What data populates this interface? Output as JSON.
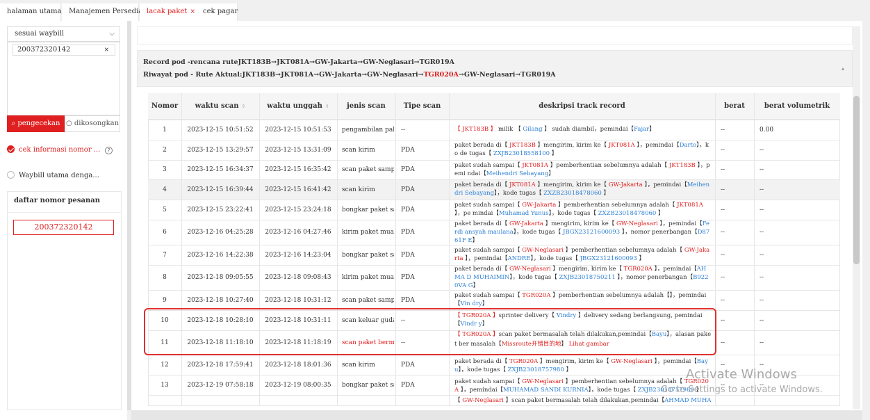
{
  "tabs": [
    {
      "label": "halaman utama"
    },
    {
      "label": "Manajemen Persediaan"
    },
    {
      "label": "lacak paket",
      "close": "×"
    },
    {
      "label": "cek pagar"
    }
  ],
  "sidebar": {
    "select_value": "sesuai waybill",
    "chevron": "⌵",
    "tag_value": "200372320142",
    "tag_close": "×",
    "search_label": "pengecekan",
    "search_icon": "⌕",
    "clear_label": "dikosongkan",
    "clear_icon": "○",
    "option1": "cek informasi nomor ...",
    "option1_help": "?",
    "option2": "Waybill utama denga...",
    "daftar_title": "daftar nomor pesanan",
    "order_item": "200372320142"
  },
  "route": {
    "record_prefix": "Record pod -rencana rute",
    "record_path": "JKT183B→JKT081A→GW-Jakarta→GW-Neglasari→TGR019A",
    "riwayat_prefix": "Riwayat pod - Rute Aktual:",
    "riwayat_before": "JKT183B→JKT081A→GW-Jakarta→GW-Neglasari→",
    "riwayat_red": "TGR020A",
    "riwayat_after": "→GW-Neglasari→TGR019A",
    "caret": "▴"
  },
  "table": {
    "headers": {
      "nomor": "Nomor",
      "waktu_scan": "waktu scan",
      "waktu_unggah": "waktu unggah",
      "jenis_scan": "jenis scan",
      "tipe_scan": "Tipe scan",
      "deskripsi": "deskripsi track record",
      "berat": "berat",
      "berat_volumetrik": "berat volumetrik"
    },
    "sort_icon": "⇕",
    "rows": [
      {
        "no": "1",
        "scan": "2023-12-15 10:51:52",
        "upload": "2023-12-15 10:51:53",
        "jenis": "pengambilan paket",
        "tipe": "--",
        "berat": "--",
        "vol": "0.00"
      },
      {
        "no": "2",
        "scan": "2023-12-15 13:29:57",
        "upload": "2023-12-15 13:31:09",
        "jenis": "scan kirim",
        "tipe": "PDA",
        "berat": "--",
        "vol": "--"
      },
      {
        "no": "3",
        "scan": "2023-12-15 16:34:37",
        "upload": "2023-12-15 16:35:42",
        "jenis": "scan paket sampai",
        "tipe": "PDA",
        "berat": "--",
        "vol": "--"
      },
      {
        "no": "4",
        "scan": "2023-12-15 16:39:44",
        "upload": "2023-12-15 16:41:42",
        "jenis": "scan kirim",
        "tipe": "PDA",
        "berat": "--",
        "vol": "--"
      },
      {
        "no": "5",
        "scan": "2023-12-15 23:22:41",
        "upload": "2023-12-15 23:24:18",
        "jenis": "bongkar paket sampai",
        "tipe": "PDA",
        "berat": "--",
        "vol": "--"
      },
      {
        "no": "6",
        "scan": "2023-12-16 04:25:28",
        "upload": "2023-12-16 04:27:46",
        "jenis": "kirim paket muatan",
        "tipe": "PDA",
        "berat": "--",
        "vol": "--"
      },
      {
        "no": "7",
        "scan": "2023-12-16 14:22:38",
        "upload": "2023-12-16 14:23:04",
        "jenis": "bongkar paket sampai",
        "tipe": "PDA",
        "berat": "--",
        "vol": "--"
      },
      {
        "no": "8",
        "scan": "2023-12-18 09:05:55",
        "upload": "2023-12-18 09:08:43",
        "jenis": "kirim paket muatan",
        "tipe": "PDA",
        "berat": "--",
        "vol": "--"
      },
      {
        "no": "9",
        "scan": "2023-12-18 10:27:40",
        "upload": "2023-12-18 10:31:12",
        "jenis": "scan paket sampai",
        "tipe": "PDA",
        "berat": "--",
        "vol": "--"
      },
      {
        "no": "10",
        "scan": "2023-12-18 10:28:10",
        "upload": "2023-12-18 10:31:11",
        "jenis": "scan keluar gudang",
        "tipe": "--",
        "berat": "--",
        "vol": "--"
      },
      {
        "no": "11",
        "scan": "2023-12-18 11:18:10",
        "upload": "2023-12-18 11:18:19",
        "jenis": "scan paket bermasalah",
        "tipe": "--",
        "berat": "--",
        "vol": "--"
      },
      {
        "no": "12",
        "scan": "2023-12-18 17:59:41",
        "upload": "2023-12-18 18:01:36",
        "jenis": "scan kirim",
        "tipe": "PDA",
        "berat": "--",
        "vol": "--"
      },
      {
        "no": "13",
        "scan": "2023-12-19 07:58:18",
        "upload": "2023-12-19 08:00:35",
        "jenis": "bongkar paket sampai",
        "tipe": "PDA",
        "berat": "--",
        "vol": "--"
      }
    ],
    "desc": {
      "r1a": "【 JKT183B 】",
      "r1b": " milik 【",
      "r1c": " Gilang ",
      "r1d": "】 sudah diambil，pemindai【",
      "r1e": "Fajar",
      "r1f": "】",
      "r2a": "paket berada di【",
      "r2b": " JKT183B ",
      "r2c": "】mengirim, kirim ke【",
      "r2d": " JKT081A ",
      "r2e": "】，pemindai【",
      "r2f": "Darto",
      "r2g": "】，ko de tugas【",
      "r2h": " ZXJB23018558100 ",
      "r2i": "】",
      "r3a": "paket sudah sampai【",
      "r3b": " JKT081A ",
      "r3c": "】pemberhentian sebelumnya adalah【",
      "r3d": " JKT183B ",
      "r3e": "】，pemi ndai【",
      "r3f": "Meihendri Sebayang",
      "r3g": "】",
      "r4a": "paket berada di【",
      "r4b": " JKT081A ",
      "r4c": "】mengirim, kirim ke【",
      "r4d": " GW-Jakarta ",
      "r4e": "】，pemindai【",
      "r4f": "Meihendri Sebayang",
      "r4g": "】，kode tugas【",
      "r4h": " ZXZB23018478060 ",
      "r4i": "】",
      "r5a": "paket sudah sampai【",
      "r5b": " GW-Jakarta ",
      "r5c": "】pemberhentian sebelumnya adalah【",
      "r5d": " JKT081A ",
      "r5e": "】，pe mindai【",
      "r5f": "Muhamad Yunus",
      "r5g": "】，kode tugas【",
      "r5h": " ZXZB23018478060 ",
      "r5i": "】",
      "r6a": "paket berada di【",
      "r6b": " GW-Jakarta ",
      "r6c": "】mengirim, kirim ke【",
      "r6d": " GW-Neglasari ",
      "r6e": "】，pemindai【",
      "r6f": "Ferdi ansyah maulana",
      "r6g": "】，kode tugas【",
      "r6h": " JBGX23121600093 ",
      "r6i": "】，nomor penerbangan【",
      "r6j": "D8761F E",
      "r6k": "】",
      "r7a": "paket sudah sampai【",
      "r7b": " GW-Neglasari ",
      "r7c": "】pemberhentian sebelumnya adalah【",
      "r7d": " GW-Jakarta ",
      "r7e": "】，pemindai【",
      "r7f": "ANDRE",
      "r7g": "】，kode tugas【",
      "r7h": " JBGX23121600093 ",
      "r7i": "】",
      "r8a": "paket berada di【",
      "r8b": " GW-Neglasari ",
      "r8c": "】mengirim, kirim ke【",
      "r8d": " TGR020A ",
      "r8e": "】，pemindai【",
      "r8f": "AHMA D MUHAIMIN",
      "r8g": "】，kode tugas【",
      "r8h": " ZXJB23018750211 ",
      "r8i": "】，nomor penerbangan【",
      "r8j": "B9220VA G",
      "r8k": "】",
      "r9a": "paket sudah sampai【",
      "r9b": " TGR020A ",
      "r9c": "】pemberhentian sebelumnya adalah【】，pemindai【",
      "r9d": "Vin dry",
      "r9e": "】",
      "r10a": "【 TGR020A 】",
      "r10b": "sprinter delivery【",
      "r10c": " Vindry ",
      "r10d": "】delivery sedang berlangsung, pemindai【",
      "r10e": "Vindr y",
      "r10f": "】",
      "r11a": "【 TGR020A 】",
      "r11b": "scan paket bermasalah telah dilakukan,pemindai【",
      "r11c": "Bayu",
      "r11d": "】，alasan paket ber masalah【",
      "r11e": "Missroute开错目的地",
      "r11f": "】 ",
      "r11g": "Lihat gambar",
      "r12a": "paket berada di【",
      "r12b": " TGR020A ",
      "r12c": "】mengirim, kirim ke【",
      "r12d": " GW-Neglasari ",
      "r12e": "】，pemindai【",
      "r12f": "Bay u",
      "r12g": "】，kode tugas【",
      "r12h": " ZXJB23018757980 ",
      "r12i": "】",
      "r13a": "paket sudah sampai【",
      "r13b": " GW-Neglasari ",
      "r13c": "】pemberhentian sebelumnya adalah【",
      "r13d": " TGR020A ",
      "r13e": "】，pemindai【",
      "r13f": "MUHAMAD SANDI KURNIA",
      "r13g": "】，kode tugas【",
      "r13h": " ZXJB23018757980 ",
      "r13i": "】",
      "r14a": "【",
      "r14b": " GW-Neglasari ",
      "r14c": "】scan paket bermasalah telah dilakukan,pemindai【",
      "r14d": "AHMAD MUHAIMI"
    }
  },
  "overlay": {
    "activate_title": "Activate Windows",
    "activate_sub": "Go to Settings to activate Windows."
  }
}
